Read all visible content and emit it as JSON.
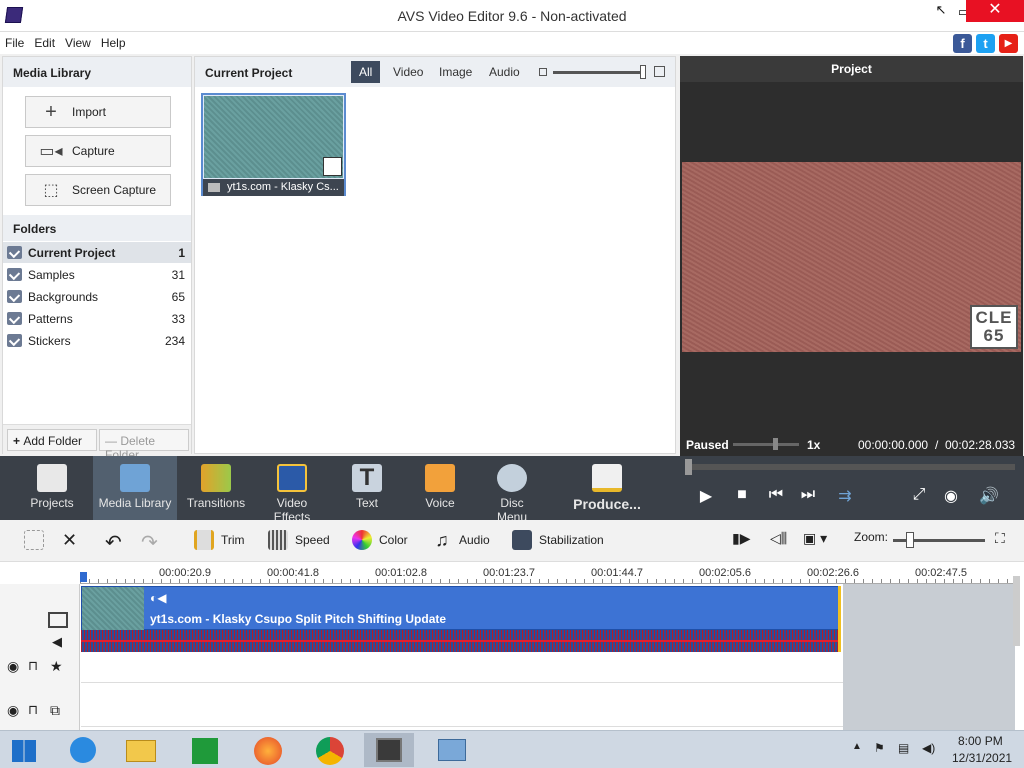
{
  "window": {
    "title": "AVS Video Editor 9.6 - Non-activated"
  },
  "menu": [
    "File",
    "Edit",
    "View",
    "Help"
  ],
  "social": {
    "facebook": "f",
    "twitter": "t",
    "youtube": "▶"
  },
  "media_library": {
    "title": "Media Library",
    "buttons": [
      "Import",
      "Capture",
      "Screen Capture"
    ],
    "folders_title": "Folders",
    "folders": [
      {
        "name": "Current Project",
        "count": "1"
      },
      {
        "name": "Samples",
        "count": "31"
      },
      {
        "name": "Backgrounds",
        "count": "65"
      },
      {
        "name": "Patterns",
        "count": "33"
      },
      {
        "name": "Stickers",
        "count": "234"
      }
    ],
    "add_folder": "Add Folder",
    "delete_folder": "Delete Folder"
  },
  "current_project": {
    "title": "Current Project",
    "filters": [
      "All",
      "Video",
      "Image",
      "Audio"
    ],
    "active_filter": "All",
    "thumb_caption": "yt1s.com - Klasky Cs..."
  },
  "preview": {
    "title": "Project",
    "logo_line1": "CLE",
    "logo_line2": "65",
    "status": "Paused",
    "speed": "1x",
    "time_current": "00:00:00.000",
    "time_sep": "/",
    "time_total": "00:02:28.033"
  },
  "main_toolbar": [
    {
      "label": "Projects"
    },
    {
      "label": "Media Library"
    },
    {
      "label": "Transitions"
    },
    {
      "label": "Video Effects"
    },
    {
      "label": "Text"
    },
    {
      "label": "Voice"
    },
    {
      "label": "Disc Menu"
    },
    {
      "label": "Produce..."
    }
  ],
  "edit_toolbar": {
    "trim": "Trim",
    "speed": "Speed",
    "color": "Color",
    "audio": "Audio",
    "stabilization": "Stabilization",
    "zoom": "Zoom:"
  },
  "timeline": {
    "ticks": [
      "00:00:20.9",
      "00:00:41.8",
      "00:01:02.8",
      "00:01:23.7",
      "00:01:44.7",
      "00:02:05.6",
      "00:02:26.6",
      "00:02:47.5"
    ],
    "clip_label": "yt1s.com - Klasky Csupo Split Pitch Shifting Update"
  },
  "taskbar": {
    "time": "8:00 PM",
    "date": "12/31/2021"
  },
  "colors": {
    "accent": "#3d73d4",
    "toolbar": "#3a4048",
    "close": "#e81123"
  }
}
